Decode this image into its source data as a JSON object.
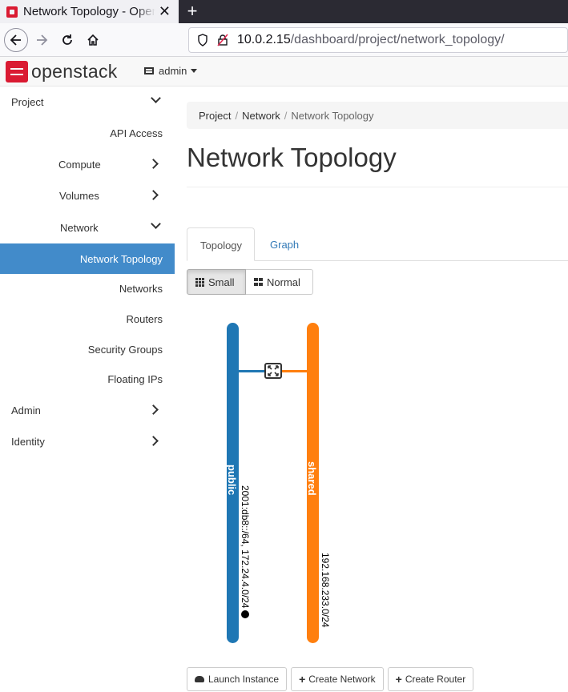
{
  "browser": {
    "tab_title": "Network Topology - OpenStack Dashboard",
    "url_host": "10.0.2.15",
    "url_path": "/dashboard/project/network_topology/"
  },
  "header": {
    "logo_text": "openstack",
    "project_label": "admin"
  },
  "sidebar": {
    "items": [
      {
        "label": "Project"
      },
      {
        "label": "API Access"
      },
      {
        "label": "Compute"
      },
      {
        "label": "Volumes"
      },
      {
        "label": "Network"
      },
      {
        "label": "Network Topology"
      },
      {
        "label": "Networks"
      },
      {
        "label": "Routers"
      },
      {
        "label": "Security Groups"
      },
      {
        "label": "Floating IPs"
      },
      {
        "label": "Admin"
      },
      {
        "label": "Identity"
      }
    ]
  },
  "breadcrumb": [
    "Project",
    "Network",
    "Network Topology"
  ],
  "page_title": "Network Topology",
  "tabs": [
    "Topology",
    "Graph"
  ],
  "size_buttons": {
    "small": "Small",
    "normal": "Normal"
  },
  "topology": {
    "networks": [
      {
        "name": "public",
        "cidr": "2001:db8::/64, 172.24.4.0/24",
        "color": "#1f77b4",
        "external": true
      },
      {
        "name": "shared",
        "cidr": "192.168.233.0/24",
        "color": "#ff7f0e",
        "external": false
      }
    ]
  },
  "actions": {
    "launch_instance": "Launch Instance",
    "create_network": "Create Network",
    "create_router": "Create Router"
  },
  "colors": {
    "accent": "#428bca",
    "brand": "#da1a32"
  }
}
